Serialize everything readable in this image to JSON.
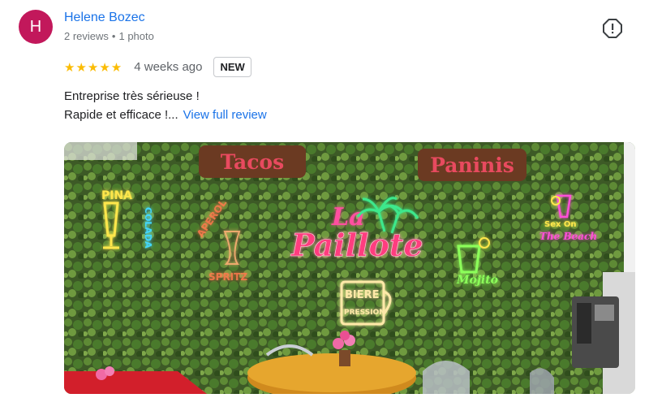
{
  "reviewer": {
    "initial": "H",
    "name": "Helene Bozec",
    "reviews": "2 reviews",
    "separator": "•",
    "photos": "1 photo"
  },
  "review": {
    "stars": "★★★★★",
    "rating": 5,
    "time": "4 weeks ago",
    "badge": "NEW",
    "line1": "Entreprise très sérieuse !",
    "line2": "Rapide et efficace !...",
    "view_full": "View full review"
  },
  "photo": {
    "signs": [
      "Tacos",
      "Paninis"
    ],
    "neon_title_1": "La",
    "neon_title_2": "Paillote",
    "neon_pina_1": "PINA",
    "neon_pina_2": "COLADA",
    "neon_aperol_1": "APEROL",
    "neon_aperol_2": "SPRITZ",
    "neon_biere_1": "BIERE",
    "neon_biere_2": "PRESSION",
    "neon_mojito": "Mojito",
    "neon_sex_1": "Sex On",
    "neon_sex_2": "The Beach"
  },
  "colors": {
    "accent": "#1a73e8",
    "avatar": "#c2185b",
    "star": "#fbbc04"
  }
}
